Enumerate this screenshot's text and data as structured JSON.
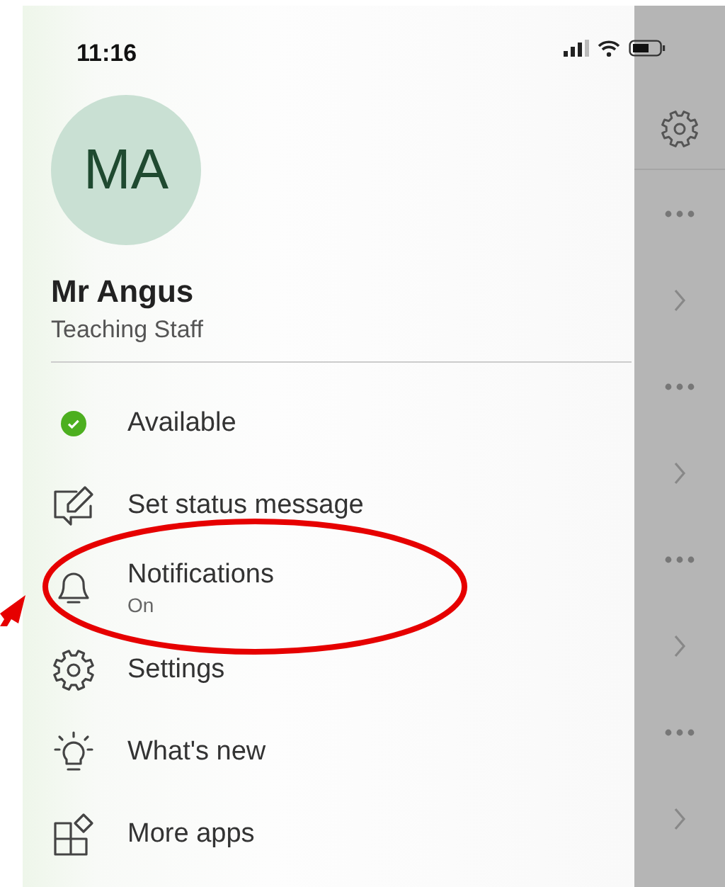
{
  "status_bar": {
    "time": "11:16"
  },
  "profile": {
    "initials": "MA",
    "name": "Mr Angus",
    "role": "Teaching Staff"
  },
  "menu": [
    {
      "kind": "status",
      "label": "Available",
      "color": "#4caf1f"
    },
    {
      "kind": "edit",
      "label": "Set status message"
    },
    {
      "kind": "bell",
      "label": "Notifications",
      "subtitle": "On"
    },
    {
      "kind": "gear",
      "label": "Settings"
    },
    {
      "kind": "bulb",
      "label": "What's new"
    },
    {
      "kind": "apps",
      "label": "More apps"
    }
  ],
  "side_strip": {
    "items": [
      {
        "kind": "more"
      },
      {
        "kind": "chevron"
      },
      {
        "kind": "more"
      },
      {
        "kind": "chevron"
      },
      {
        "kind": "more"
      },
      {
        "kind": "chevron"
      },
      {
        "kind": "more"
      },
      {
        "kind": "chevron"
      }
    ]
  },
  "annotations": {
    "highlight_ellipse": true,
    "pointer_arrow": true
  }
}
